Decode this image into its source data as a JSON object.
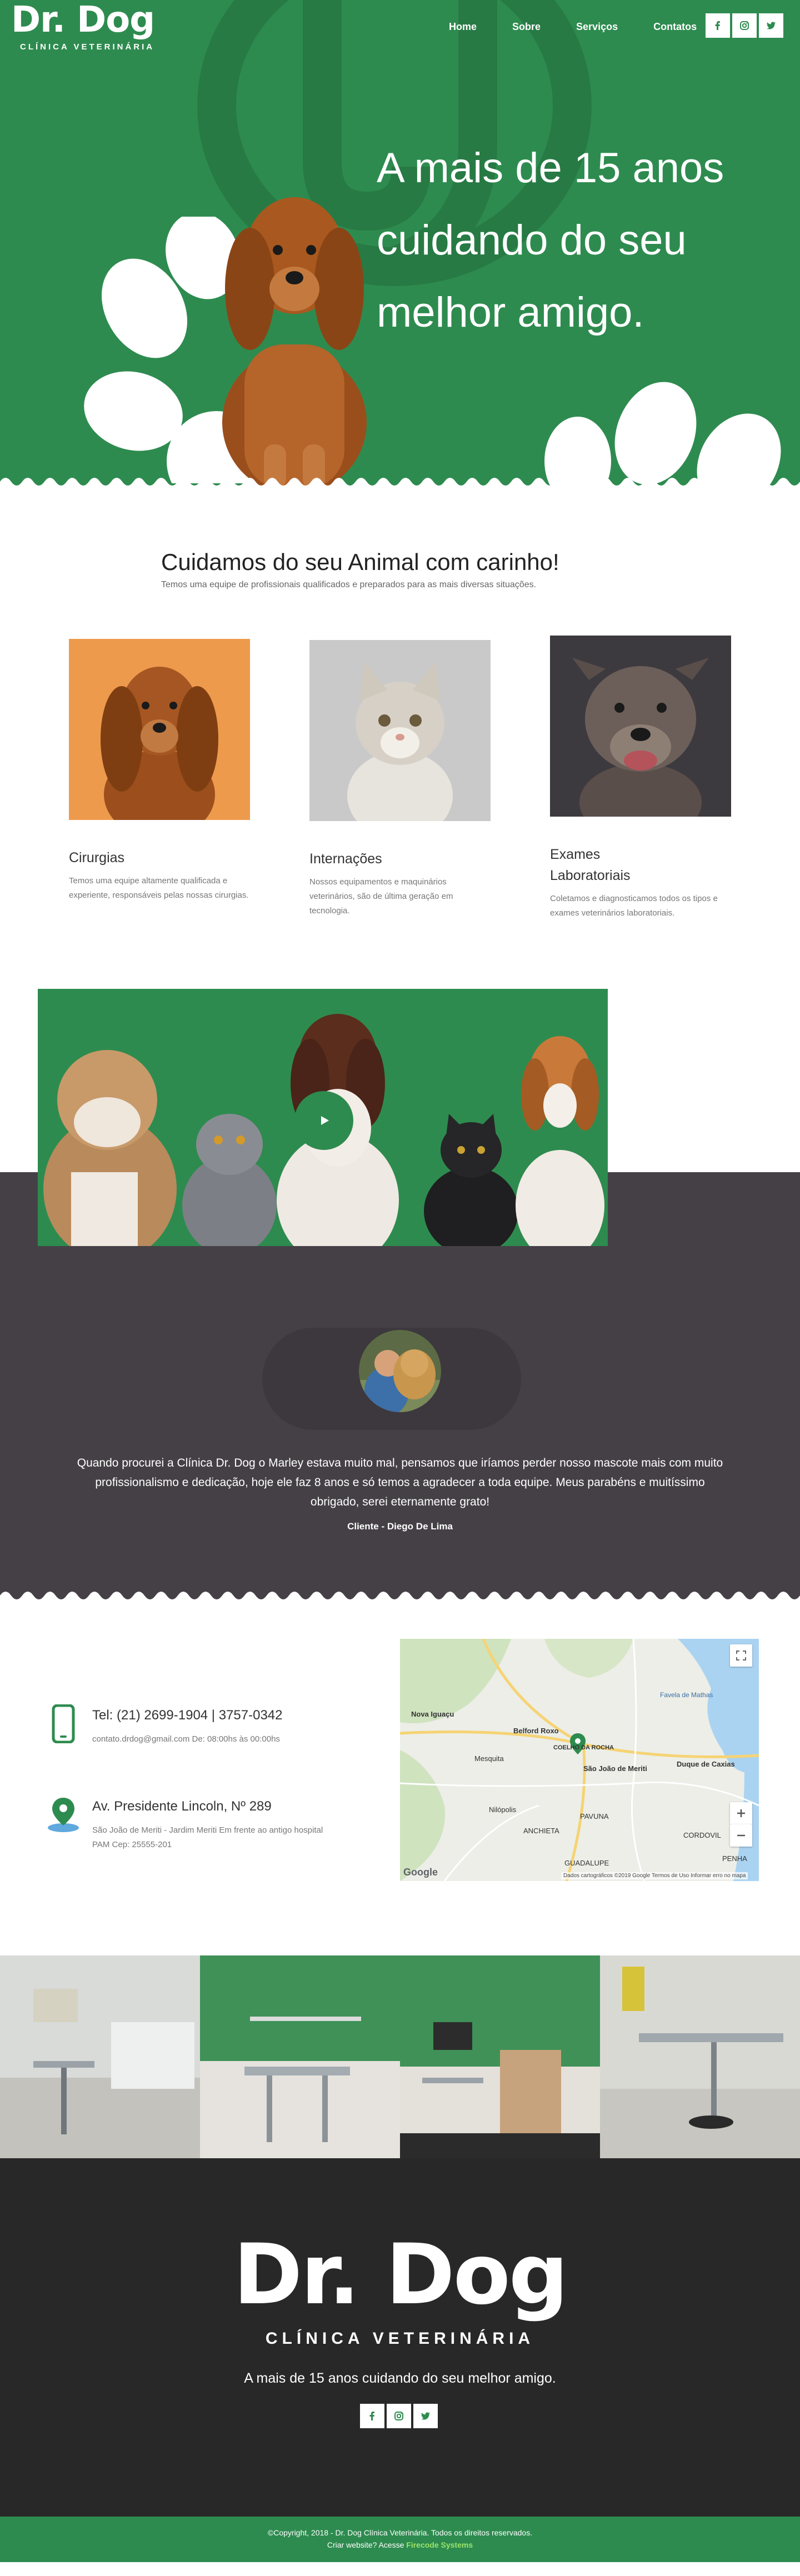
{
  "nav": {
    "brand_title": "Dr. Dog",
    "brand_subtitle": "CLÍNICA VETERINÁRIA",
    "menu": [
      "Home",
      "Sobre",
      "Serviços",
      "Contatos"
    ],
    "social_icons": [
      "facebook-icon",
      "instagram-icon",
      "twitter-icon"
    ]
  },
  "hero": {
    "line1": "A mais de 15 anos",
    "line2": "cuidando do seu",
    "line3": "melhor amigo."
  },
  "services": {
    "title": "Cuidamos do seu Animal com carinho!",
    "lead": "Temos uma equipe de profissionais qualificados e preparados para as mais diversas situações.",
    "cards": [
      {
        "title": "Cirurgias",
        "text": "Temos uma equipe altamente qualificada e experiente, responsáveis pelas nossas cirurgias."
      },
      {
        "title": "Internações",
        "text": "Nossos equipamentos e maquinários veterinários, são de última geração em tecnologia."
      },
      {
        "title": "Exames Laboratoriais",
        "text": "Coletamos e diagnosticamos todos os tipos e exames veterinários laboratoriais."
      }
    ]
  },
  "testimonial": {
    "quote": "Quando procurei a Clínica Dr. Dog o Marley estava muito mal, pensamos que iríamos perder nosso mascote mais com muito profissionalismo e dedicação, hoje ele faz 8 anos e só temos a agradecer a toda equipe. Meus parabéns e muitíssimo obrigado, serei eternamente grato!",
    "author": "Cliente - Diego De Lima"
  },
  "contact": {
    "phone_title": "Tel: (21) 2699-1904 | 3757-0342",
    "phone_text": "contato.drdog@gmail.com De: 08:00hs às 00:00hs",
    "address_title": "Av. Presidente Lincoln, Nº 289",
    "address_text": "São João de Meriti - Jardim Meriti Em frente ao antigo hospital PAM Cep: 25555-201"
  },
  "map": {
    "labels": [
      "Nova Iguaçu",
      "Belford Roxo",
      "Mesquita",
      "COELHO DA ROCHA",
      "São João de Meriti",
      "Duque de Caxias",
      "Nilópolis",
      "PAVUNA",
      "ANCHIETA",
      "CORDOVIL",
      "GUADALUPE",
      "PENHA",
      "Favela de Mathas"
    ],
    "attribution": "Dados cartográficos ©2019 Google   Termos de Uso   Informar erro no mapa",
    "google": "Google"
  },
  "footer": {
    "title": "Dr. Dog",
    "subtitle": "CLÍNICA VETERINÁRIA",
    "tagline": "A mais de 15 anos cuidando do seu melhor amigo.",
    "copyright": "©Copyright, 2018 - Dr. Dog Clínica Veterinária. Todos os direitos reservados.",
    "credit_prefix": "Criar website? Acesse",
    "credit_link": "Firecode Systems"
  },
  "colors": {
    "green": "#2e8b4f",
    "dark": "#454046",
    "footer": "#282828"
  }
}
